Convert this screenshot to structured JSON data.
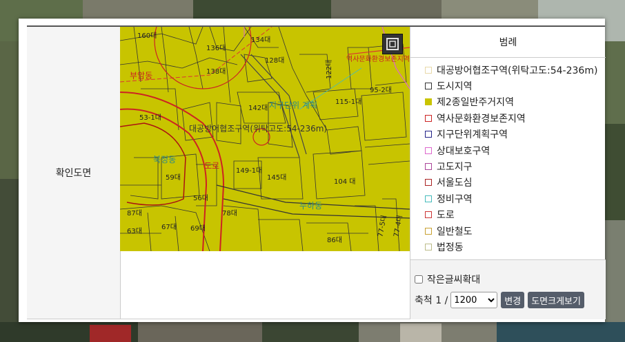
{
  "row_label": "확인도면",
  "legend": {
    "title": "범례",
    "items": [
      {
        "label": "대공방어협조구역(위탁고도:54-236m)",
        "color": "#e8d9a8",
        "fill": "#ffffff"
      },
      {
        "label": "도시지역",
        "color": "#333333",
        "fill": "#ffffff"
      },
      {
        "label": "제2종일반주거지역",
        "color": "#c9c400",
        "fill": "#c9c400"
      },
      {
        "label": "역사문화환경보존지역",
        "color": "#cc2222",
        "fill": "#ffffff"
      },
      {
        "label": "지구단위계획구역",
        "color": "#222288",
        "fill": "#ffffff"
      },
      {
        "label": "상대보호구역",
        "color": "#dd66cc",
        "fill": "#ffffff"
      },
      {
        "label": "고도지구",
        "color": "#aa4499",
        "fill": "#ffffff"
      },
      {
        "label": "서울도심",
        "color": "#aa2222",
        "fill": "#ffffff"
      },
      {
        "label": "정비구역",
        "color": "#44bbbb",
        "fill": "#ffffff"
      },
      {
        "label": "도로",
        "color": "#cc3333",
        "fill": "#ffffff"
      },
      {
        "label": "일반철도",
        "color": "#c8a030",
        "fill": "#ffffff"
      },
      {
        "label": "법정동",
        "color": "#bbbb88",
        "fill": "#ffffff"
      }
    ]
  },
  "controls": {
    "zoom_label": "작은글씨확대",
    "scale_prefix": "축척 1 /",
    "scale_selected": "1200",
    "change_button": "변경",
    "enlarge_button": "도면크게보기"
  },
  "map_labels": {
    "parcels": [
      "134대",
      "136대",
      "138대",
      "142대",
      "115-1대",
      "53-1대",
      "59대",
      "145대",
      "104 대",
      "149-1대",
      "56대",
      "67대",
      "69대",
      "78대",
      "87대",
      "86대",
      "77-5대",
      "77-4대",
      "122대",
      "95-2대",
      "128대",
      "63대",
      "160대"
    ],
    "zone": "대공방어협조구역(위탁고도:54-236m)",
    "dong1": "북정동",
    "dong2": "도로",
    "dong3": "부암동",
    "dong4": "역사문화환경보존지역",
    "dong5": "지구단위 계획",
    "dong6": "누하동"
  },
  "colors": {
    "map_fill": "#c8c400",
    "lot_line": "#333333"
  }
}
